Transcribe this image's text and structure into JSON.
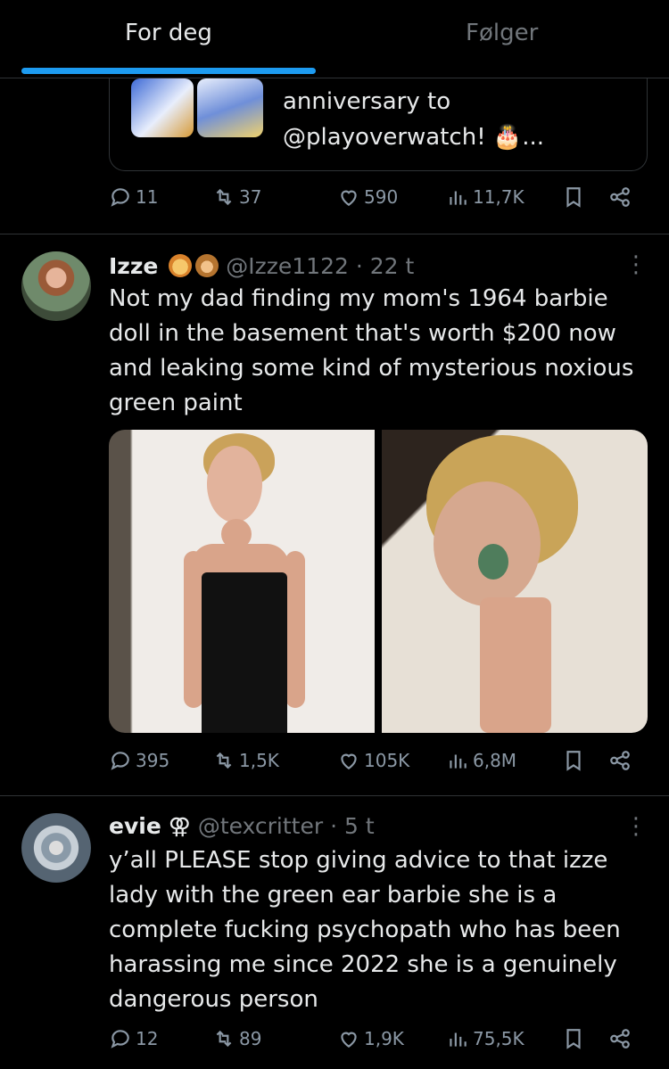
{
  "tabs": [
    {
      "label": "For deg"
    },
    {
      "label": "Følger"
    }
  ],
  "quote": {
    "text_line1": "anniversary to",
    "text_line2": "@playoverwatch! 🎂..."
  },
  "tweet0_actions": {
    "replies": "11",
    "retweets": "37",
    "likes": "590",
    "views": "11,7K"
  },
  "tweet1": {
    "name": "Izze",
    "handle": "@Izze1122",
    "time": "· 22 t",
    "text": "Not my dad finding my mom's 1964 barbie doll in the basement that's worth $200 now and leaking some kind of mysterious noxious green paint",
    "actions": {
      "replies": "395",
      "retweets": "1,5K",
      "likes": "105K",
      "views": "6,8M"
    }
  },
  "tweet2": {
    "name": "evie",
    "symbol": "⚢",
    "handle": "@texcritter",
    "time": "· 5 t",
    "text": "y’all PLEASE stop giving advice to that izze lady with the green ear barbie she is a complete fucking psychopath who has been harassing me since 2022 she is a genuinely dangerous person",
    "actions": {
      "replies": "12",
      "retweets": "89",
      "likes": "1,9K",
      "views": "75,5K"
    }
  },
  "colors": {
    "accent": "#1d9bf0",
    "muted": "#71767b",
    "text": "#e7e9ea",
    "divider": "#2f3336"
  }
}
